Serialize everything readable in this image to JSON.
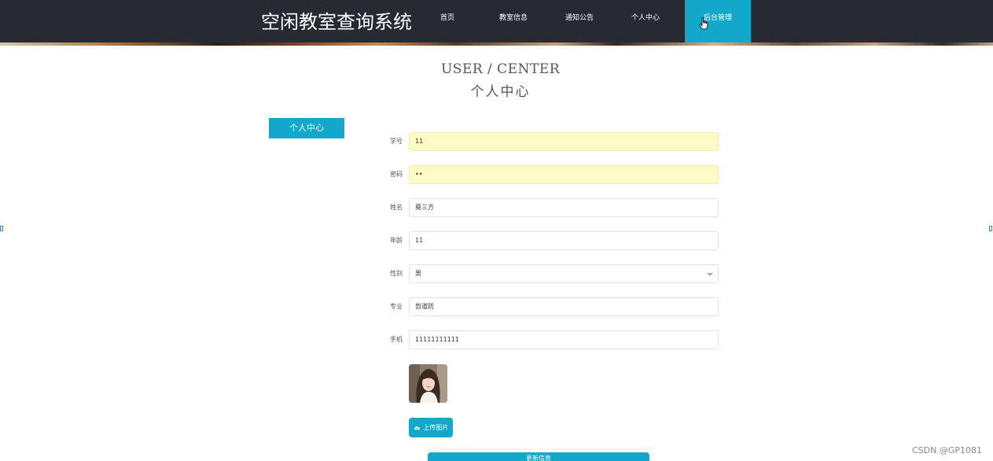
{
  "site": {
    "title": "空闲教室查询系统"
  },
  "nav": {
    "items": [
      {
        "label": "首页"
      },
      {
        "label": "教室信息"
      },
      {
        "label": "通知公告"
      },
      {
        "label": "个人中心"
      },
      {
        "label": "后台管理"
      }
    ],
    "active_index": 4
  },
  "page": {
    "heading_en": "USER / CENTER",
    "heading_cn": "个人中心"
  },
  "sidebar": {
    "button_label": "个人中心"
  },
  "form": {
    "student_id": {
      "label": "学号",
      "value": "11"
    },
    "password": {
      "label": "密码",
      "value": "••"
    },
    "name": {
      "label": "姓名",
      "value": "莫三方"
    },
    "age": {
      "label": "年龄",
      "value": "11"
    },
    "gender": {
      "label": "性别",
      "value": "男"
    },
    "major": {
      "label": "专业",
      "value": "哲道防"
    },
    "phone": {
      "label": "手机",
      "value": "11111111111"
    }
  },
  "actions": {
    "upload_label": "上传图片",
    "save_label": "更新信息"
  },
  "watermark": "CSDN @GP1081",
  "colors": {
    "accent": "#13a7c9",
    "header_bg": "#262a33",
    "autofill_bg": "#fbfbc3"
  }
}
